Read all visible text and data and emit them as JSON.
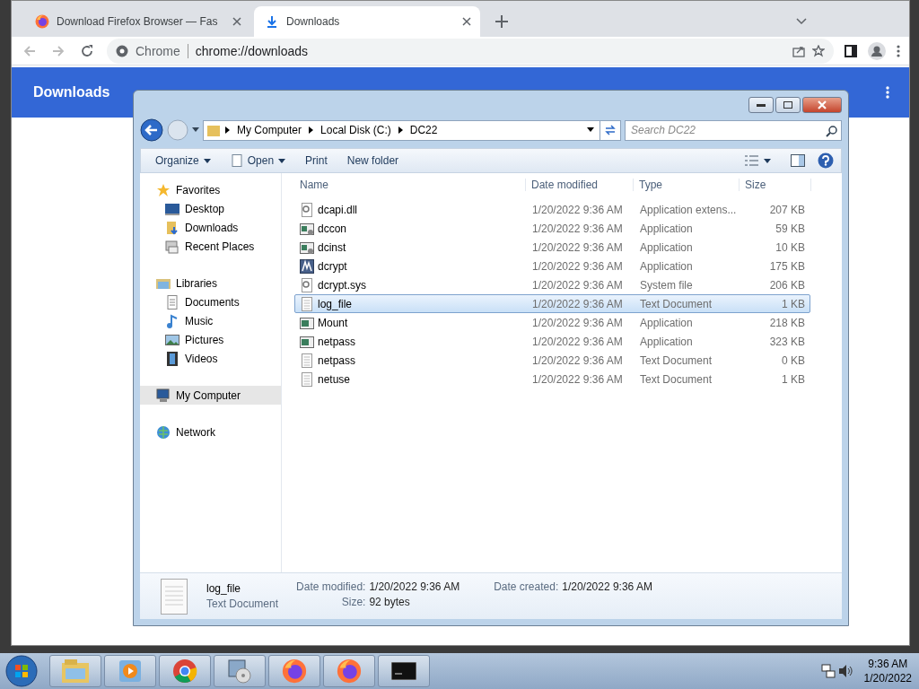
{
  "browser": {
    "tabs": [
      {
        "title": "Download Firefox Browser — Fas",
        "kind": "firefox",
        "selected": false
      },
      {
        "title": "Downloads",
        "kind": "download",
        "selected": true
      }
    ],
    "omnibox": {
      "chip": "Chrome",
      "url": "chrome://downloads"
    },
    "page_title": "Downloads"
  },
  "explorer": {
    "breadcrumb": [
      "My Computer",
      "Local Disk (C:)",
      "DC22"
    ],
    "search": {
      "placeholder": "Search DC22"
    },
    "toolbar": [
      {
        "label": "Organize",
        "dropdown": true,
        "kind": "plain"
      },
      {
        "label": "Open",
        "dropdown": true,
        "kind": "document"
      },
      {
        "label": "Print",
        "dropdown": false,
        "kind": "plain"
      },
      {
        "label": "New folder",
        "dropdown": false,
        "kind": "plain"
      }
    ],
    "nav": [
      {
        "label": "Favorites",
        "kind": "star",
        "selected": false,
        "children": [
          {
            "label": "Desktop",
            "kind": "desktop",
            "selected": false
          },
          {
            "label": "Downloads",
            "kind": "downloads",
            "selected": false
          },
          {
            "label": "Recent Places",
            "kind": "recent",
            "selected": false
          }
        ]
      },
      {
        "label": "Libraries",
        "kind": "library",
        "selected": false,
        "children": [
          {
            "label": "Documents",
            "kind": "documents",
            "selected": false
          },
          {
            "label": "Music",
            "kind": "music",
            "selected": false
          },
          {
            "label": "Pictures",
            "kind": "pictures",
            "selected": false
          },
          {
            "label": "Videos",
            "kind": "videos",
            "selected": false
          }
        ]
      },
      {
        "label": "My Computer",
        "kind": "computer",
        "selected": true
      },
      {
        "label": "Network",
        "kind": "network",
        "selected": false
      }
    ],
    "columns": [
      "Name",
      "Date modified",
      "Type",
      "Size"
    ],
    "rows": [
      {
        "name": "dcapi.dll",
        "date": "1/20/2022 9:36 AM",
        "type": "Application extens...",
        "size": "207 KB",
        "kind": "gear",
        "selected": false
      },
      {
        "name": "dccon",
        "date": "1/20/2022 9:36 AM",
        "type": "Application",
        "size": "59 KB",
        "kind": "setup",
        "selected": false
      },
      {
        "name": "dcinst",
        "date": "1/20/2022 9:36 AM",
        "type": "Application",
        "size": "10 KB",
        "kind": "setup",
        "selected": false
      },
      {
        "name": "dcrypt",
        "date": "1/20/2022 9:36 AM",
        "type": "Application",
        "size": "175 KB",
        "kind": "program",
        "selected": false
      },
      {
        "name": "dcrypt.sys",
        "date": "1/20/2022 9:36 AM",
        "type": "System file",
        "size": "206 KB",
        "kind": "gear",
        "selected": false
      },
      {
        "name": "log_file",
        "date": "1/20/2022 9:36 AM",
        "type": "Text Document",
        "size": "1 KB",
        "kind": "text",
        "selected": true
      },
      {
        "name": "Mount",
        "date": "1/20/2022 9:36 AM",
        "type": "Application",
        "size": "218 KB",
        "kind": "app",
        "selected": false
      },
      {
        "name": "netpass",
        "date": "1/20/2022 9:36 AM",
        "type": "Application",
        "size": "323 KB",
        "kind": "app",
        "selected": false
      },
      {
        "name": "netpass",
        "date": "1/20/2022 9:36 AM",
        "type": "Text Document",
        "size": "0 KB",
        "kind": "text",
        "selected": false
      },
      {
        "name": "netuse",
        "date": "1/20/2022 9:36 AM",
        "type": "Text Document",
        "size": "1 KB",
        "kind": "text",
        "selected": false
      }
    ],
    "details": {
      "name": "log_file",
      "type": "Text Document",
      "fields": [
        {
          "label": "Date modified:",
          "value": "1/20/2022 9:36 AM"
        },
        {
          "label": "Size:",
          "value": "92 bytes"
        },
        {
          "label": "Date created:",
          "value": "1/20/2022 9:36 AM"
        }
      ]
    }
  },
  "taskbar": {
    "items": [
      {
        "kind": "folder"
      },
      {
        "kind": "player"
      },
      {
        "kind": "chrome"
      },
      {
        "kind": "installer"
      },
      {
        "kind": "firefox"
      },
      {
        "kind": "firefox"
      },
      {
        "kind": "console"
      }
    ],
    "time": "9:36 AM",
    "date": "1/20/2022"
  }
}
